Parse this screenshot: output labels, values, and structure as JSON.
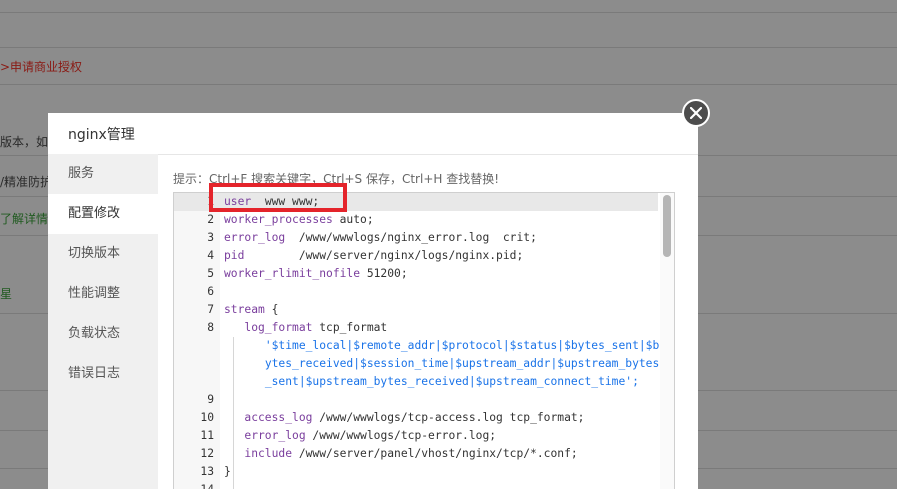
{
  "background": {
    "lines": [
      {
        "text": ">申请商业授权",
        "tone": "red"
      },
      {
        "text": "版本，如果",
        "tone": "dark"
      },
      {
        "text": "/精准防护",
        "tone": "dark"
      },
      {
        "text": "了解详情]",
        "tone": "green"
      },
      {
        "text": "星",
        "tone": "green"
      }
    ]
  },
  "modal": {
    "title": "nginx管理",
    "close_icon": "close-icon",
    "sidebar": {
      "items": [
        {
          "label": "服务",
          "active": false
        },
        {
          "label": "配置修改",
          "active": true
        },
        {
          "label": "切换版本",
          "active": false
        },
        {
          "label": "性能调整",
          "active": false
        },
        {
          "label": "负载状态",
          "active": false
        },
        {
          "label": "错误日志",
          "active": false
        }
      ]
    },
    "hint": "提示：Ctrl+F 搜索关键字，Ctrl+S 保存，Ctrl+H 查找替换!",
    "editor": {
      "lines": [
        {
          "num": "1",
          "code": "user  www www;",
          "kw": "user"
        },
        {
          "num": "2",
          "code": "worker_processes auto;",
          "kw": "worker_processes"
        },
        {
          "num": "3",
          "code": "error_log  /www/wwwlogs/nginx_error.log  crit;",
          "kw": "error_log"
        },
        {
          "num": "4",
          "code": "pid        /www/server/nginx/logs/nginx.pid;",
          "kw": "pid"
        },
        {
          "num": "5",
          "code": "worker_rlimit_nofile 51200;",
          "kw": "worker_rlimit_nofile"
        },
        {
          "num": "6",
          "code": ""
        },
        {
          "num": "7",
          "code": "stream {",
          "kw": "stream"
        },
        {
          "num": "8",
          "code": "   log_format tcp_format",
          "kw": "log_format"
        },
        {
          "num": "",
          "code": "      '$time_local|$remote_addr|$protocol|$status|$bytes_sent|$b",
          "str": true
        },
        {
          "num": "",
          "code": "      ytes_received|$session_time|$upstream_addr|$upstream_bytes",
          "str": true
        },
        {
          "num": "",
          "code": "      _sent|$upstream_bytes_received|$upstream_connect_time';",
          "str": true
        },
        {
          "num": "9",
          "code": ""
        },
        {
          "num": "10",
          "code": "   access_log /www/wwwlogs/tcp-access.log tcp_format;",
          "kw": "access_log"
        },
        {
          "num": "11",
          "code": "   error_log /www/wwwlogs/tcp-error.log;",
          "kw": "error_log"
        },
        {
          "num": "12",
          "code": "   include /www/server/panel/vhost/nginx/tcp/*.conf;",
          "kw": "include"
        },
        {
          "num": "13",
          "code": "}"
        },
        {
          "num": "14",
          "code": ""
        }
      ]
    }
  },
  "colors": {
    "highlight_border": "#e4242b",
    "keyword": "#7a3e9d",
    "string": "#1a73e8"
  }
}
